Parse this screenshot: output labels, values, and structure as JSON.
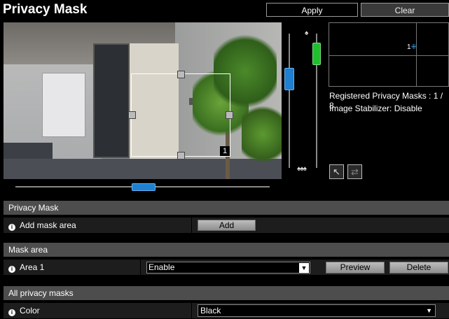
{
  "header": {
    "title": "Privacy Mask",
    "apply_label": "Apply",
    "clear_label": "Clear"
  },
  "camera": {
    "mask_number": "1"
  },
  "sliders": {
    "zoom_level": 0.3,
    "focus_level": 0.08,
    "pan_level": 0.5
  },
  "preview": {
    "marker_label": "1",
    "marker_symbol": "⁜"
  },
  "info": {
    "registered": "Registered Privacy Masks : 1 / 8",
    "stabilizer": "Image Stabilizer: Disable"
  },
  "icons": {
    "pointer": "↖",
    "swap": "⇄",
    "info": "i",
    "dropdown": "▼"
  },
  "sections": {
    "privacy_mask": {
      "header": "Privacy Mask",
      "add_label": "Add mask area",
      "add_button": "Add"
    },
    "mask_area": {
      "header": "Mask area",
      "area_label": "Area 1",
      "area_value": "Enable",
      "preview_button": "Preview",
      "delete_button": "Delete"
    },
    "all_privacy_masks": {
      "header": "All privacy masks",
      "color_label": "Color",
      "color_value": "Black"
    }
  },
  "colors": {
    "accent_blue": "#1f7fd0",
    "accent_green": "#1fbf2e",
    "section_header": "#4d4d4d"
  }
}
